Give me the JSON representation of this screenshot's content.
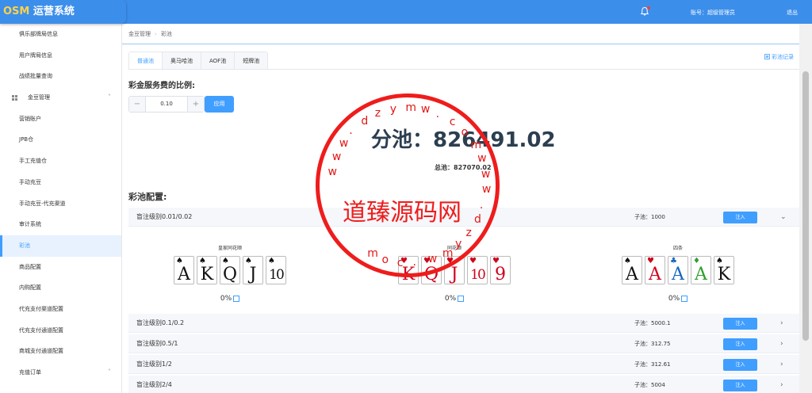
{
  "brand": {
    "logo_prefix": "OSM",
    "logo_suffix": "运营系统"
  },
  "header": {
    "account": "账号：超级管理员",
    "logout": "退出"
  },
  "sidebar": {
    "items": [
      {
        "label": "俱乐部牌局信息"
      },
      {
        "label": "用户牌局信息"
      },
      {
        "label": "战绩批量查询"
      },
      {
        "label": "金豆管理",
        "group": true
      },
      {
        "label": "营销账户"
      },
      {
        "label": "JPB仓"
      },
      {
        "label": "手工充值仓"
      },
      {
        "label": "手动充豆"
      },
      {
        "label": "手动充豆-代充渠道"
      },
      {
        "label": "审计系统"
      },
      {
        "label": "彩池",
        "active": true
      },
      {
        "label": "商品配置"
      },
      {
        "label": "内购配置"
      },
      {
        "label": "代充支付渠道配置"
      },
      {
        "label": "代充支付通道配置"
      },
      {
        "label": "商城支付通道配置"
      },
      {
        "label": "充值订单",
        "caret": true
      }
    ]
  },
  "breadcrumb": {
    "parent": "金豆管理",
    "current": "彩池"
  },
  "tabs": [
    {
      "label": "普通池",
      "active": true
    },
    {
      "label": "奥马哈池"
    },
    {
      "label": "AOF池"
    },
    {
      "label": "短牌池"
    }
  ],
  "record_link": "彩池记录",
  "fee": {
    "title": "彩金服务费的比例:",
    "value": "0.10",
    "minus": "−",
    "plus": "+",
    "apply": "应用"
  },
  "pool": {
    "big": "分池：826491.02",
    "total": "总池：827070.02"
  },
  "config": {
    "title": "彩池配置:",
    "rows": [
      {
        "level": "盲注级别0.01/0.02",
        "sub": "子池：1000",
        "inject": "注入",
        "chevron": "⌄"
      },
      {
        "level": "盲注级别0.1/0.2",
        "sub": "子池：5000.1",
        "inject": "注入",
        "chevron": "›"
      },
      {
        "level": "盲注级别0.5/1",
        "sub": "子池：312.75",
        "inject": "注入",
        "chevron": "›"
      },
      {
        "level": "盲注级别1/2",
        "sub": "子池：312.61",
        "inject": "注入",
        "chevron": "›"
      },
      {
        "level": "盲注级别2/4",
        "sub": "子池：5004",
        "inject": "注入",
        "chevron": "›"
      }
    ]
  },
  "hands": [
    {
      "name": "皇家同花顺",
      "pct": "0%",
      "cards": [
        {
          "suit": "♠",
          "rank": "A",
          "color": "#111"
        },
        {
          "suit": "♠",
          "rank": "K",
          "color": "#111"
        },
        {
          "suit": "♠",
          "rank": "Q",
          "color": "#111"
        },
        {
          "suit": "♠",
          "rank": "J",
          "color": "#111"
        },
        {
          "suit": "♠",
          "rank": "10",
          "color": "#111"
        }
      ]
    },
    {
      "name": "同花顺",
      "pct": "0%",
      "cards": [
        {
          "suit": "♥",
          "rank": "K",
          "color": "#d0021b"
        },
        {
          "suit": "♥",
          "rank": "Q",
          "color": "#d0021b"
        },
        {
          "suit": "♥",
          "rank": "J",
          "color": "#d0021b"
        },
        {
          "suit": "♥",
          "rank": "10",
          "color": "#d0021b"
        },
        {
          "suit": "♥",
          "rank": "9",
          "color": "#d0021b"
        }
      ]
    },
    {
      "name": "四条",
      "pct": "0%",
      "cards": [
        {
          "suit": "♠",
          "rank": "A",
          "color": "#111"
        },
        {
          "suit": "♥",
          "rank": "A",
          "color": "#d0021b"
        },
        {
          "suit": "♣",
          "rank": "A",
          "color": "#1565c0"
        },
        {
          "suit": "♦",
          "rank": "A",
          "color": "#2e9e2e"
        },
        {
          "suit": "♠",
          "rank": "K",
          "color": "#111"
        }
      ]
    }
  ],
  "watermark": {
    "text": "道臻源码网",
    "ring_chars": [
      "w",
      "w",
      "w",
      ".",
      "d",
      "z",
      "y",
      "m",
      "w",
      ".",
      "c",
      "o",
      "m",
      "w",
      "w",
      "w",
      ".",
      "d",
      "z",
      "y",
      "m",
      "w",
      ".",
      "c",
      "o",
      "m"
    ]
  },
  "icons": {
    "bell": "bell-icon",
    "record": "list-icon",
    "edit": "edit-icon",
    "grid": "grid-icon"
  }
}
